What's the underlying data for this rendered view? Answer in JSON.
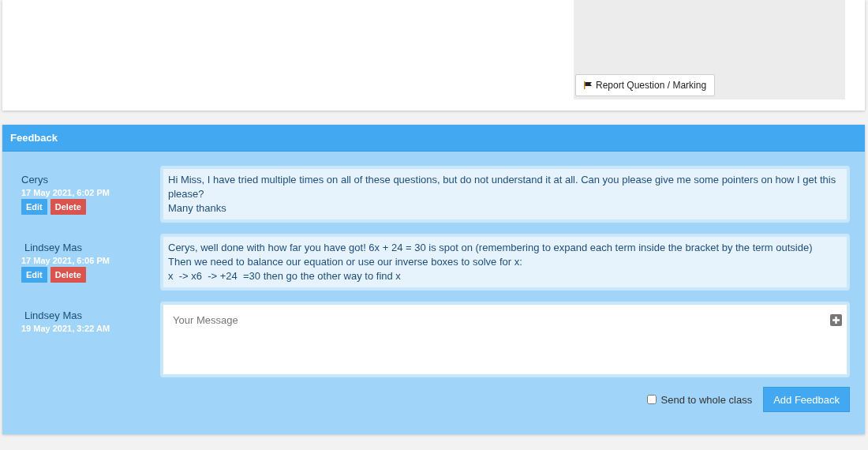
{
  "report_button": {
    "label": "Report Question / Marking"
  },
  "feedback": {
    "title": "Feedback",
    "messages": [
      {
        "author": "Cerys",
        "date": "17 May 2021, 6:02 PM",
        "actions": [
          "Edit",
          "Delete"
        ],
        "lines": [
          "Hi Miss, I have tried multiple times on all of these questions, but do not understand it at all. Can you please give me some pointers on how I get this please?",
          "Many thanks"
        ]
      },
      {
        "author": "Lindsey Mas",
        "date": "17 May 2021, 6:06 PM",
        "actions": [
          "Edit",
          "Delete"
        ],
        "lines": [
          "Cerys, well done with how far you have got! 6x + 24 = 30 is spot on (remembering to expand each term inside the bracket by the term outside)",
          "Then we need to balance our equation or use our inverse boxes to solve for x:",
          "x  -> x6  -> +24  =30 then go the other way to find x"
        ]
      }
    ],
    "compose": {
      "author": "Lindsey Mas",
      "date": "19 May 2021, 3:22 AM",
      "placeholder": "Your Message"
    },
    "send_to_class": {
      "label": "Send to whole class",
      "checked": false
    },
    "submit": {
      "label": "Add Feedback"
    }
  }
}
